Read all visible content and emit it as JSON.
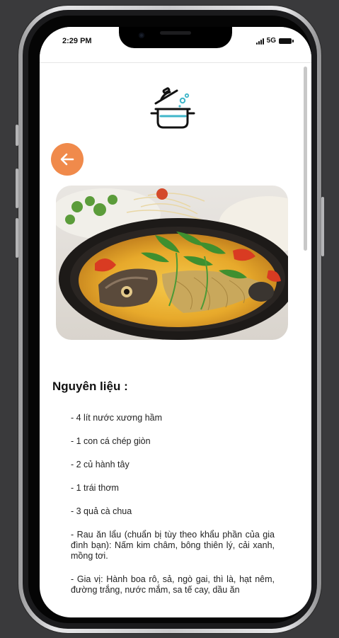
{
  "status_bar": {
    "time": "2:29 PM",
    "network": "5G"
  },
  "header": {
    "logo_icon": "cooking-pot-icon"
  },
  "back_button": {
    "icon": "arrow-left-icon",
    "color": "#f08a4b"
  },
  "dish_image": {
    "icon": "fish-hotpot-photo"
  },
  "ingredients": {
    "title": "Nguyên liệu :",
    "items": [
      "- 4 lít nước xương hầm",
      "- 1 con cá chép giòn",
      "- 2 củ hành tây",
      "- 1 trái thơm",
      "- 3 quả cà chua",
      "- Rau ăn lẩu (chuẩn bị tùy theo khẩu phần của gia đình bạn): Nấm kim châm, bông thiên lý, cải xanh, mồng tơi.",
      "- Gia vị: Hành boa rô, sả, ngò gai, thì là, hạt nêm, đường trắng, nước mắm, sa tế cay, dầu ăn"
    ]
  }
}
